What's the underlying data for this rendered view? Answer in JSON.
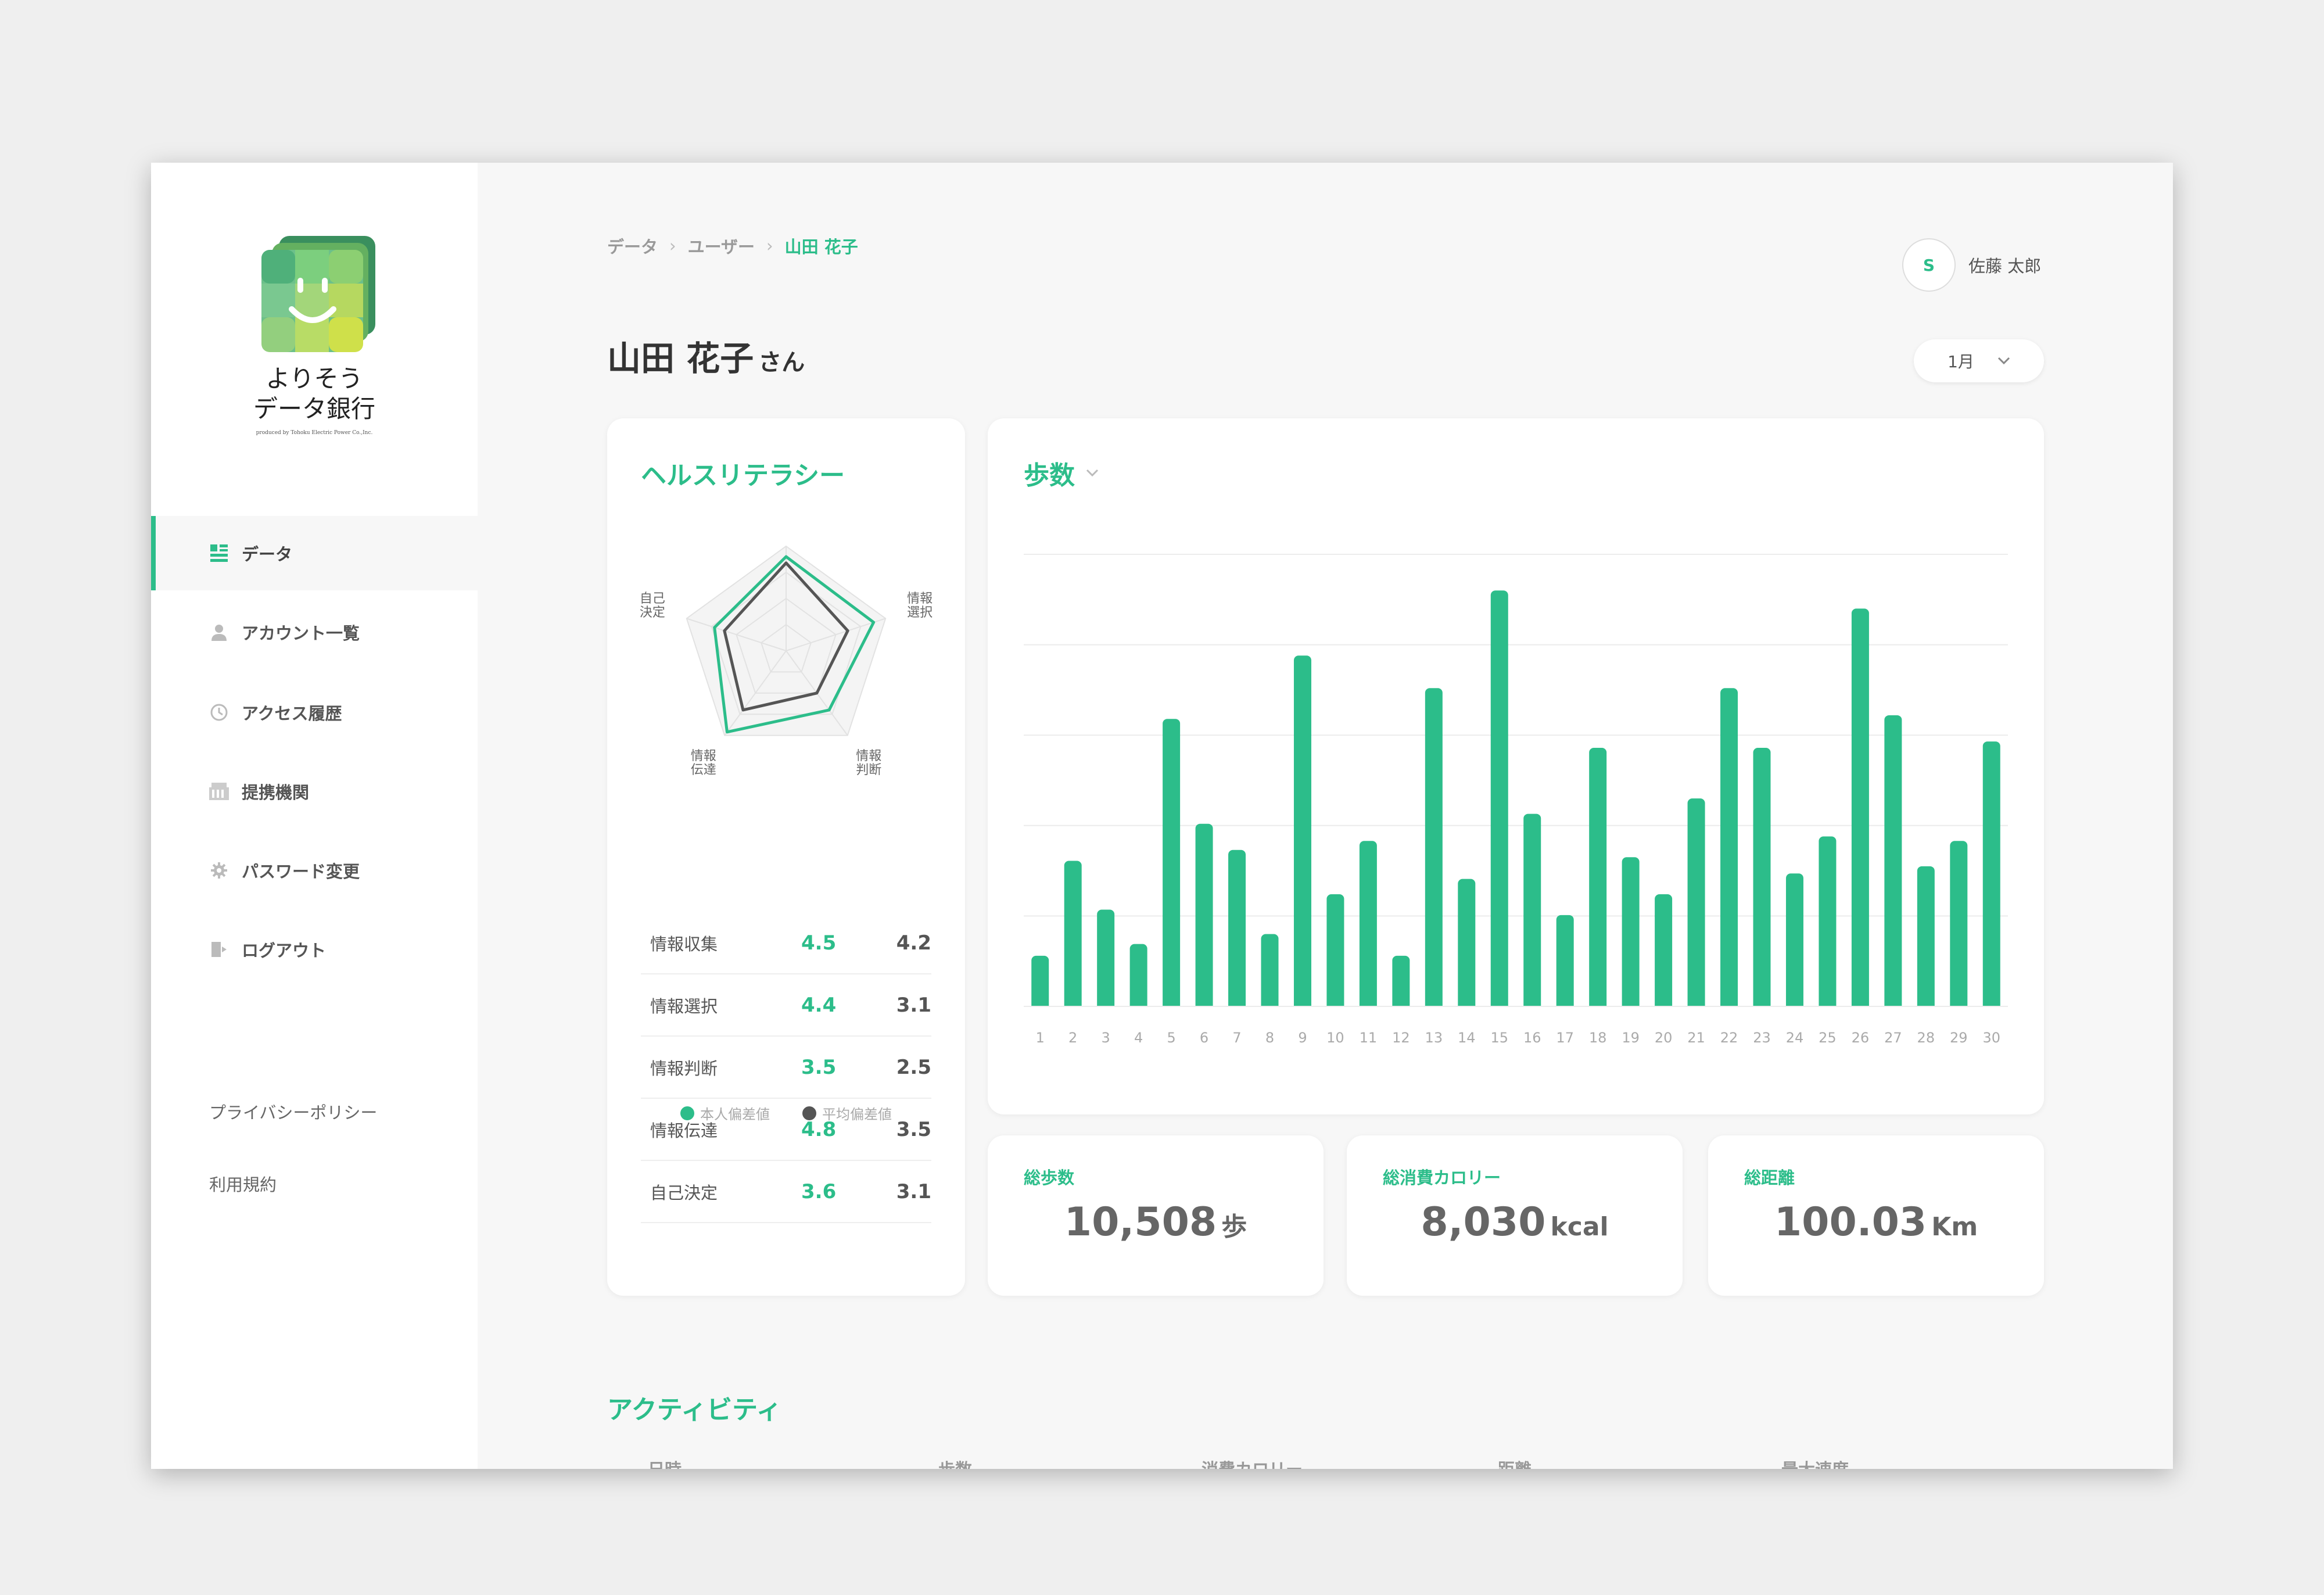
{
  "brand": {
    "name_line1": "よりそう",
    "name_line2": "データ銀行",
    "tagline": "produced by Tohoku Electric Power Co.,Inc."
  },
  "colors": {
    "accent": "#2cbd8a",
    "average": "#555555"
  },
  "sidebar": {
    "items": [
      {
        "label": "データ",
        "icon": "dashboard-icon",
        "active": true
      },
      {
        "label": "アカウント一覧",
        "icon": "person-icon"
      },
      {
        "label": "アクセス履歴",
        "icon": "history-clock-icon"
      },
      {
        "label": "提携機関",
        "icon": "building-icon"
      },
      {
        "label": "パスワード変更",
        "icon": "gear-icon"
      },
      {
        "label": "ログアウト",
        "icon": "logout-icon"
      }
    ],
    "footer": [
      "プライバシーポリシー",
      "利用規約"
    ]
  },
  "header": {
    "breadcrumb": [
      "データ",
      "ユーザー",
      "山田 花子"
    ],
    "user_initial": "S",
    "user_name": "佐藤 太郎",
    "title": "山田 花子",
    "title_suffix": "さん",
    "month": "1月"
  },
  "health": {
    "title": "ヘルスリテラシー",
    "axes": [
      [
        "情報",
        "収集"
      ],
      [
        "情報",
        "選択"
      ],
      [
        "情報",
        "判断"
      ],
      [
        "情報",
        "伝達"
      ],
      [
        "自己",
        "決定"
      ]
    ],
    "radar_max": 5,
    "legend_self": "本人偏差値",
    "legend_avg": "平均偏差値",
    "rows": [
      {
        "label": "情報収集",
        "self": "4.5",
        "avg": "4.2"
      },
      {
        "label": "情報選択",
        "self": "4.4",
        "avg": "3.1"
      },
      {
        "label": "情報判断",
        "self": "3.5",
        "avg": "2.5"
      },
      {
        "label": "情報伝達",
        "self": "4.8",
        "avg": "3.5"
      },
      {
        "label": "自己決定",
        "self": "3.6",
        "avg": "3.1"
      }
    ]
  },
  "steps_chart": {
    "title": "歩数"
  },
  "chart_data": {
    "type": "bar",
    "categories": [
      "1",
      "2",
      "3",
      "4",
      "5",
      "6",
      "7",
      "8",
      "9",
      "10",
      "11",
      "12",
      "13",
      "14",
      "15",
      "16",
      "17",
      "18",
      "19",
      "20",
      "21",
      "22",
      "23",
      "24",
      "25",
      "26",
      "27",
      "28",
      "29",
      "30"
    ],
    "values": [
      560,
      1610,
      1070,
      690,
      3180,
      2020,
      1730,
      800,
      3880,
      1240,
      1830,
      560,
      3520,
      1410,
      4600,
      2130,
      1010,
      2860,
      1650,
      1240,
      2300,
      3520,
      2860,
      1470,
      1880,
      4400,
      3220,
      1550,
      1830,
      2930
    ],
    "ylim": [
      0,
      5000
    ],
    "grid": true
  },
  "stats": [
    {
      "label": "総歩数",
      "value": "10,508",
      "unit": "歩"
    },
    {
      "label": "総消費カロリー",
      "value": "8,030",
      "unit": "kcal"
    },
    {
      "label": "総距離",
      "value": "100.03",
      "unit": "Km"
    }
  ],
  "activity": {
    "title": "アクティビティ",
    "columns": [
      "日時",
      "歩数",
      "消費カロリー",
      "距離",
      "最大速度"
    ]
  }
}
